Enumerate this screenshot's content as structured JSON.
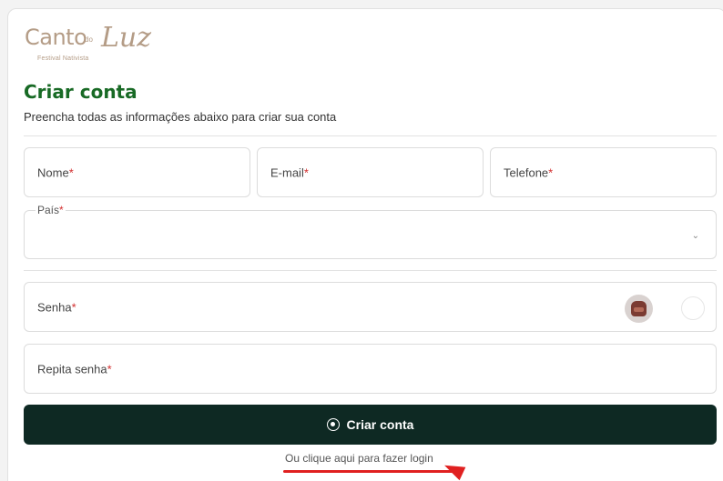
{
  "logo": {
    "word": "Canto",
    "small": "do",
    "script": "Luz",
    "tagline": "Festival Nativista"
  },
  "header": {
    "title": "Criar conta",
    "subtitle": "Preencha todas as informações abaixo para criar sua conta"
  },
  "fields": {
    "nome": "Nome",
    "email": "E-mail",
    "telefone": "Telefone",
    "pais": "País",
    "senha": "Senha",
    "repita_senha": "Repita senha",
    "required_marker": "*"
  },
  "submit": {
    "label": "Criar conta"
  },
  "login_link": {
    "label": "Ou clique aqui para fazer login"
  },
  "colors": {
    "title": "#186a25",
    "button": "#0e2923",
    "required": "#d32f2f",
    "annotation": "#e02020",
    "logo": "#b49c86"
  }
}
